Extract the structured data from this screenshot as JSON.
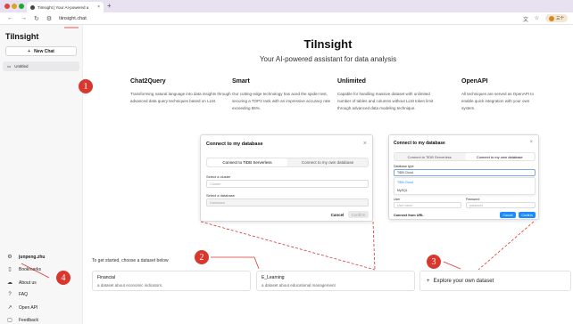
{
  "browser": {
    "tab_title": "TiInsight | Your AI-powered a",
    "tab_close": "×",
    "new_tab": "+",
    "url": "tiinsight.chat",
    "profile_badge": "三个"
  },
  "sidebar": {
    "brand": "TiInsight",
    "new_chat": "New Chat",
    "chat_items": [
      "Untitled"
    ],
    "bottom_items": [
      {
        "label": "junpeng.zhu",
        "icon": "gear-icon"
      },
      {
        "label": "Bookmarks",
        "icon": "bookmark-icon"
      },
      {
        "label": "About us",
        "icon": "cloud-icon"
      },
      {
        "label": "FAQ",
        "icon": "help-icon"
      },
      {
        "label": "Open API",
        "icon": "external-link-icon"
      },
      {
        "label": "Feedback",
        "icon": "feedback-icon"
      }
    ]
  },
  "main": {
    "title": "TiInsight",
    "subtitle": "Your AI-powered assistant for data analysis",
    "features": [
      {
        "title": "Chat2Query",
        "desc": "Transforming natural language into data insights through advanced data query techniques based on LLM."
      },
      {
        "title": "Smart",
        "desc": "Our cutting-edge technology has aced the spider test, securing a TOP3 rank with an impressive accuracy rate exceeding 86%."
      },
      {
        "title": "Unlimited",
        "desc": "Capable for handling massive dataset with unlimited number of tables and columns without LLM token limit through advanced data modeling technique."
      },
      {
        "title": "OpenAPI",
        "desc": "All techniques are served as OpenAPI to enable quick integration with your own system."
      }
    ]
  },
  "dialog_left": {
    "title": "Connect to my database",
    "close": "×",
    "tabs": [
      "Connect to TiDB Serverless",
      "Connect to my own database"
    ],
    "cluster_label": "Select a cluster",
    "cluster_placeholder": "Cluster",
    "database_label": "Select a database",
    "database_placeholder": "Database",
    "cancel": "Cancel",
    "confirm": "Confirm"
  },
  "dialog_right": {
    "title": "Connect to my database",
    "close": "×",
    "tabs": [
      "Connect to TiDB Serverless",
      "Connect to my own database"
    ],
    "db_type_label": "Database type",
    "db_type_value": "TiDB Cloud",
    "options": [
      "TiDB Cloud",
      "MySQL"
    ],
    "user_label": "User",
    "user_placeholder": "User name",
    "password_label": "Password",
    "password_placeholder": "password",
    "url_link": "Connect from URL",
    "cancel": "Cancel",
    "confirm": "Confirm"
  },
  "datasets": {
    "heading": "To get started, choose a dataset below",
    "items": [
      {
        "title": "Financial",
        "desc": "a dataset about economic indicators."
      },
      {
        "title": "E_Learning",
        "desc": "a dataset about educational management"
      }
    ],
    "explore": "Explore your own dataset"
  },
  "annotations": [
    "1",
    "2",
    "3",
    "4"
  ],
  "colors": {
    "marker": "#d9372d",
    "primary_button": "#1a8cff"
  }
}
